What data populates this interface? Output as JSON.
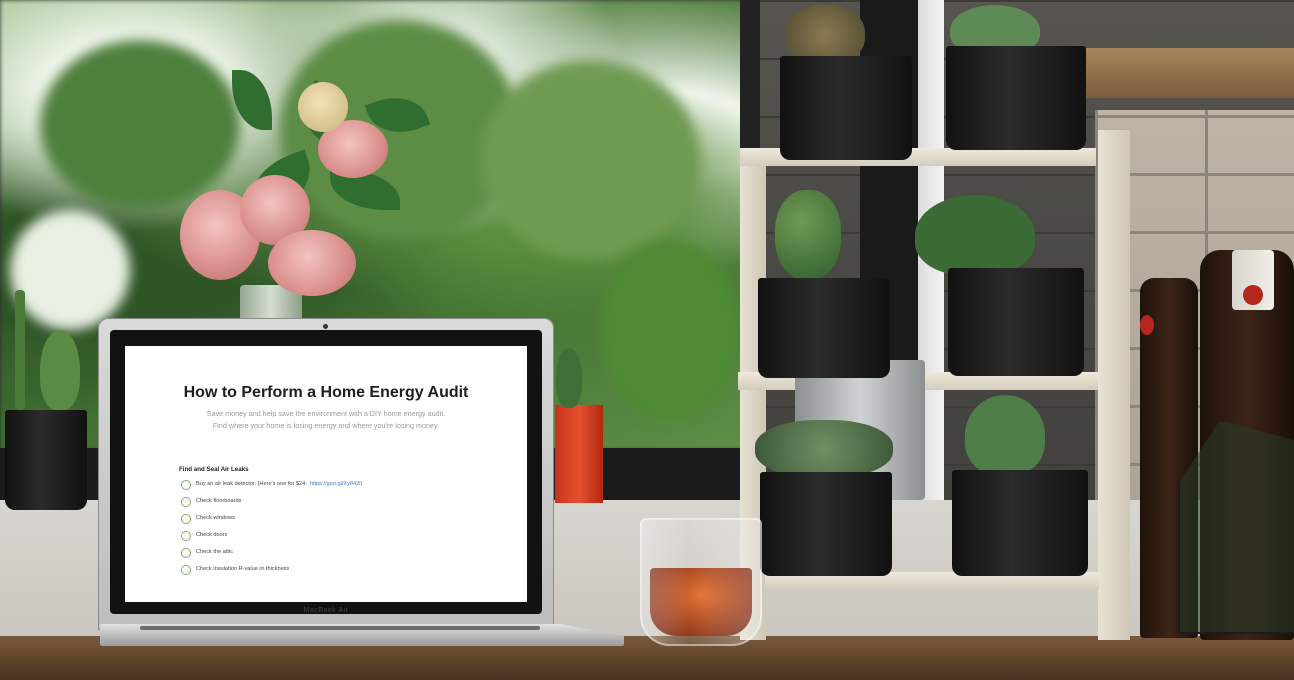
{
  "photo": {
    "subject": "laptop-on-windowsill",
    "laptop_brand": "MacBook Air",
    "screen": {
      "title": "How to Perform a Home Energy Audit",
      "subtitle_lines": [
        "Save money and help save the environment with a DIY home energy audit.",
        "Find where your home is losing energy and where you're losing money."
      ],
      "section_heading": "Find and Seal Air Leaks",
      "tasks": [
        {
          "text": "Buy an air leak detector. (Here's one for $24:",
          "link": "https://goo.gl/Xy842l)"
        },
        {
          "text": "Check floorboards"
        },
        {
          "text": "Check windows"
        },
        {
          "text": "Check doors"
        },
        {
          "text": "Check the attic"
        },
        {
          "text": "Check insulation R-value or thickness"
        }
      ]
    },
    "colors": {
      "checkbox_green": "#7fae5c",
      "link_blue": "#3a78c8",
      "tea_amber": "#e0641e",
      "red_pot": "#e4522e"
    }
  }
}
